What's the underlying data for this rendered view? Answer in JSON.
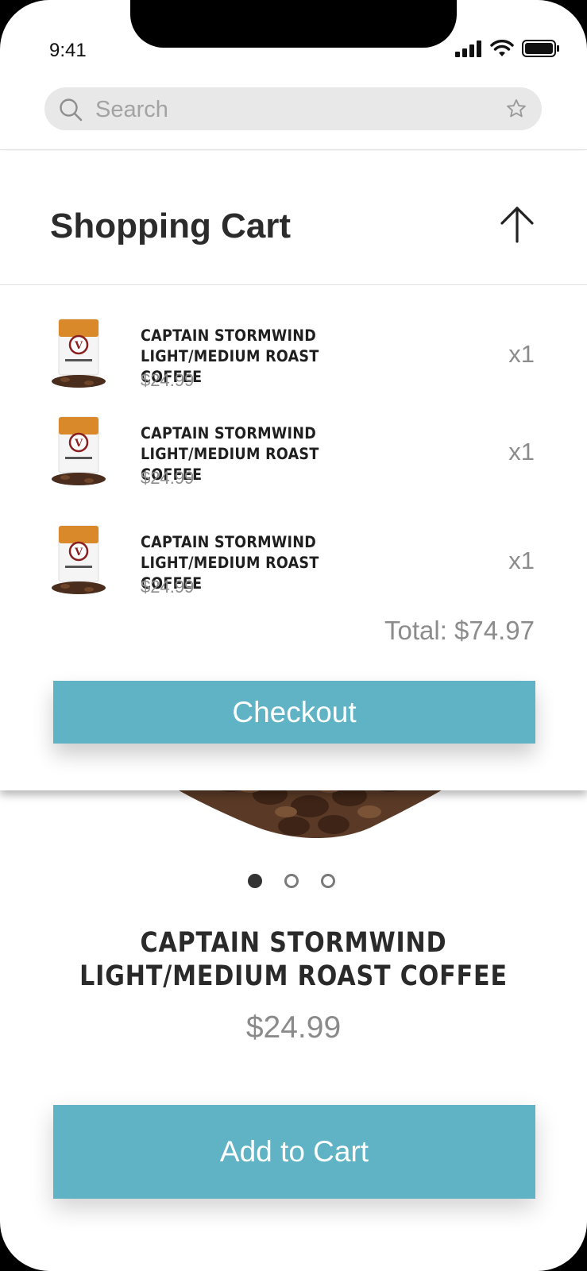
{
  "status_bar": {
    "time": "9:41"
  },
  "search": {
    "placeholder": "Search"
  },
  "cart": {
    "title": "Shopping Cart",
    "items": [
      {
        "name_line1": "CAPTAIN STORMWIND",
        "name_line2": "LIGHT/MEDIUM ROAST COFFEE",
        "price": "$24.99",
        "qty": "x1"
      },
      {
        "name_line1": "CAPTAIN STORMWIND",
        "name_line2": "LIGHT/MEDIUM ROAST COFFEE",
        "price": "$24.99",
        "qty": "x1"
      },
      {
        "name_line1": "CAPTAIN STORMWIND",
        "name_line2": "LIGHT/MEDIUM ROAST COFFEE",
        "price": "$24.99",
        "qty": "x1"
      }
    ],
    "total": "Total: $74.97",
    "checkout_label": "Checkout"
  },
  "product": {
    "title_line1": "CAPTAIN STORMWIND",
    "title_line2": "LIGHT/MEDIUM ROAST COFFEE",
    "price": "$24.99",
    "add_to_cart_label": "Add to Cart",
    "carousel": {
      "count": 3,
      "active_index": 0
    }
  },
  "colors": {
    "accent": "#5fb3c4",
    "text_dark": "#2b2b2b",
    "text_muted": "#8c8c8c"
  },
  "icons": [
    "signal-icon",
    "wifi-icon",
    "battery-icon",
    "search-icon",
    "star-icon",
    "arrow-up-icon"
  ]
}
